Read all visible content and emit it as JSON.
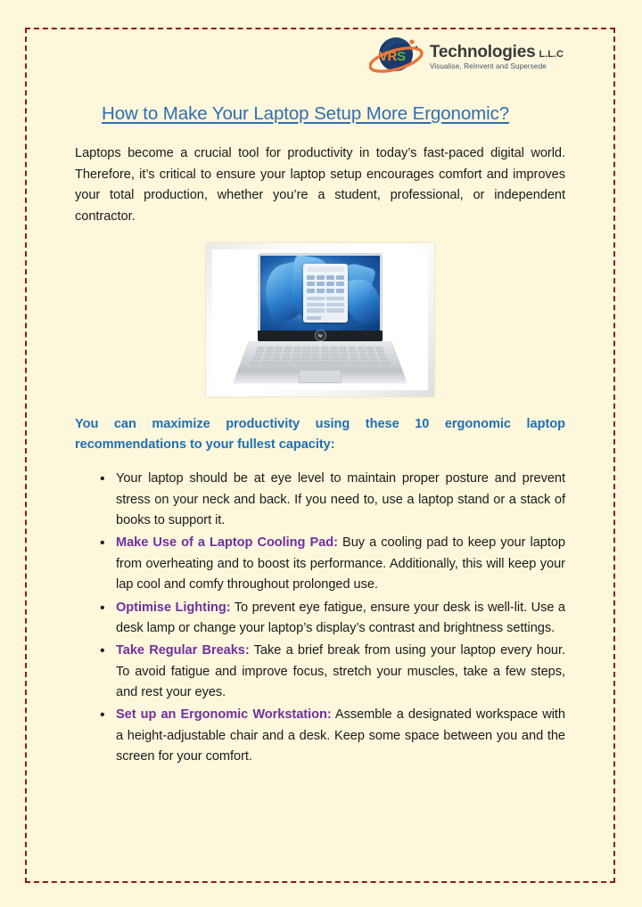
{
  "logo": {
    "mark_letters": [
      "V",
      "R",
      "S"
    ],
    "brand": "Technologies",
    "suffix": "L.L.C",
    "tagline": "Visualise, ReInvent and Supersede",
    "colors": {
      "globe": "#1b3a6b",
      "ring": "#e8743b",
      "v": "#f08a2c",
      "r": "#f08a2c",
      "s": "#5cb531",
      "text": "#3a3a3a"
    }
  },
  "document": {
    "title": "How to Make Your Laptop Setup More Ergonomic?",
    "title_color": "#2e6db4",
    "border_color": "#8d1f10",
    "background_color": "#fdf8dc",
    "intro": "Laptops become a crucial tool for productivity in today’s fast-paced digital world. Therefore, it’s critical to ensure your laptop setup encourages comfort and improves your total production, whether you’re a student, professional, or independent contractor.",
    "figure_alt": "HP laptop displaying Windows 11 desktop with Start menu open",
    "subheading": "You can maximize productivity using these 10 ergonomic laptop recommendations to your fullest capacity:",
    "subheading_color": "#1f6fb5",
    "lead_color": "#7030a0",
    "tips": [
      {
        "lead": "",
        "text": "Your laptop should be at eye level to maintain proper posture and prevent stress on your neck and back. If you need to, use a laptop stand or a stack of books to support it."
      },
      {
        "lead": "Make Use of a Laptop Cooling Pad:",
        "text": " Buy a cooling pad to keep your laptop from overheating and to boost its performance. Additionally, this will keep your lap cool and comfy throughout prolonged use."
      },
      {
        "lead": "Optimise Lighting:",
        "text": " To prevent eye fatigue, ensure your desk is well-lit. Use a desk lamp or change your laptop’s display’s contrast and brightness settings."
      },
      {
        "lead": "Take Regular Breaks:",
        "text": " Take a brief break from using your laptop every hour. To avoid fatigue and improve focus, stretch your muscles, take a few steps, and rest your eyes."
      },
      {
        "lead": "Set up an Ergonomic Workstation:",
        "text": " Assemble a designated workspace with a height-adjustable chair and a desk. Keep some space between you and the screen for your comfort."
      }
    ]
  }
}
